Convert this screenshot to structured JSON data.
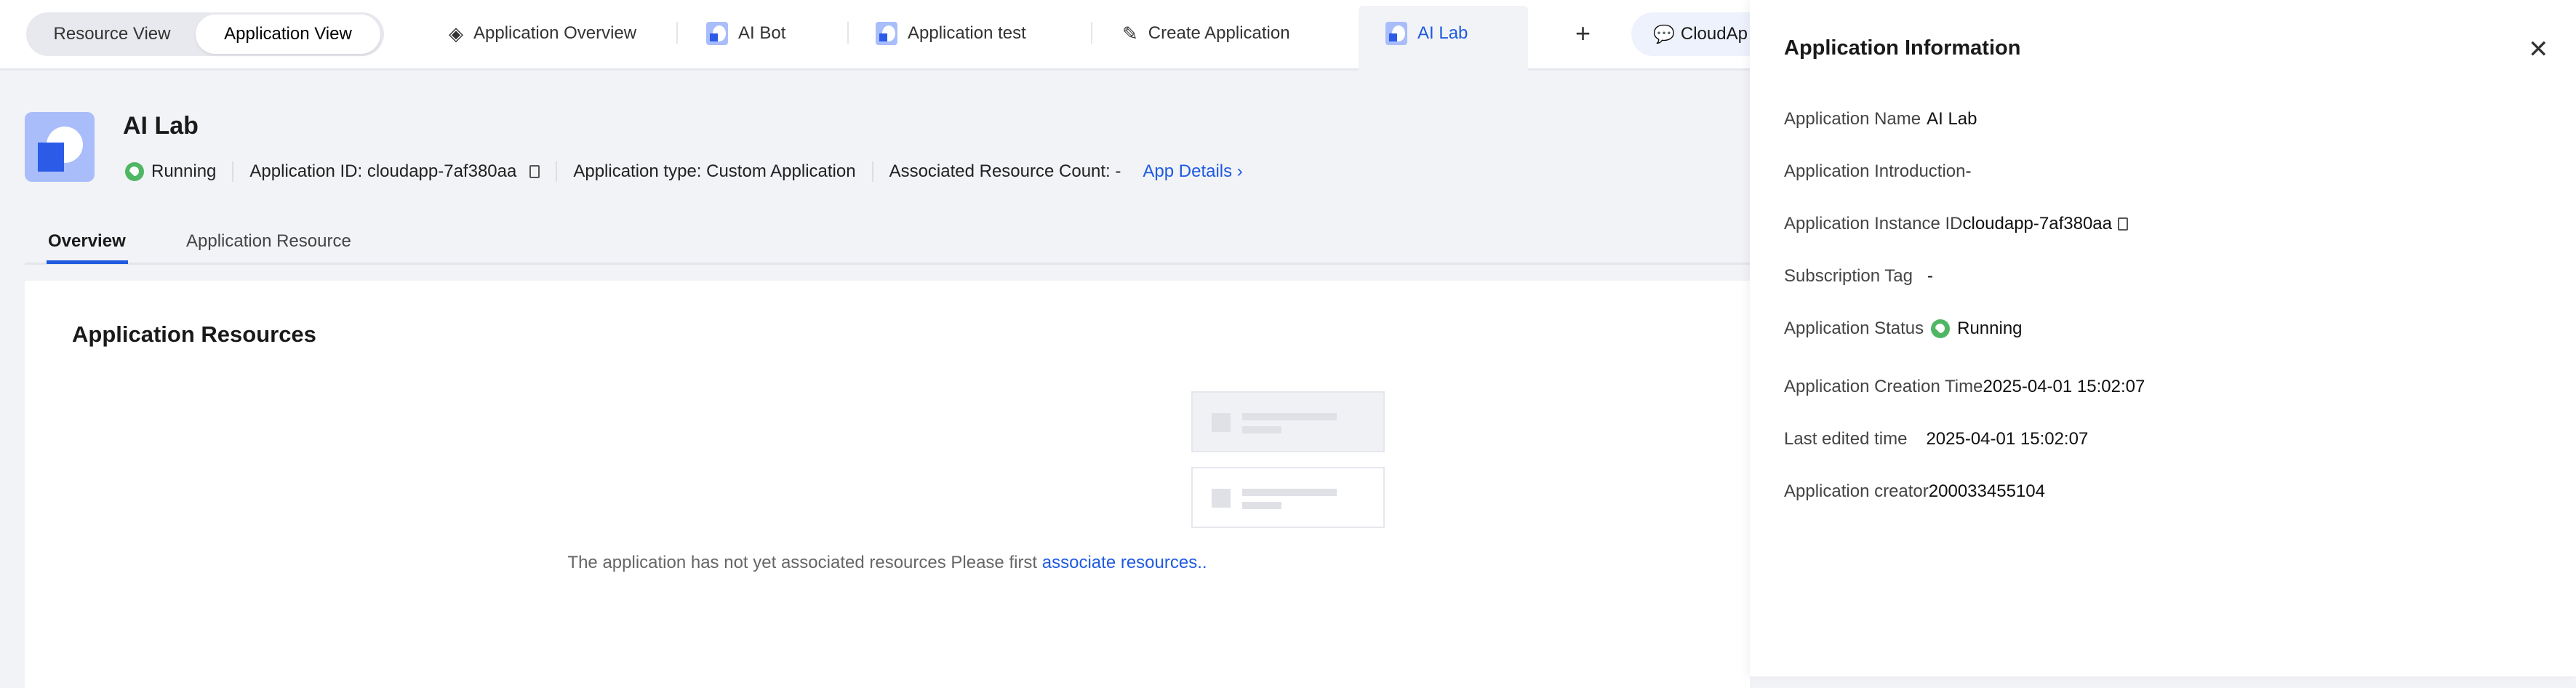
{
  "topbar": {
    "view_switch": {
      "resource": "Resource View",
      "application": "Application View"
    },
    "tabs": [
      {
        "label": "Application Overview",
        "icon": "layers-icon"
      },
      {
        "label": "AI Bot",
        "icon": "app-icon"
      },
      {
        "label": "Application test",
        "icon": "app-icon"
      },
      {
        "label": "Create Application",
        "icon": "pencil-icon"
      },
      {
        "label": "AI Lab",
        "icon": "app-icon",
        "active": true
      }
    ],
    "add": "+",
    "cloud": "CloudAp"
  },
  "app": {
    "name": "AI Lab",
    "status": "Running",
    "id_label": "Application ID: cloudapp-7af380aa",
    "type_label": "Application type: Custom Application",
    "resource_count": "Associated Resource Count: -",
    "details_link": "App Details"
  },
  "subtabs": [
    "Overview",
    "Application Resource"
  ],
  "resources": {
    "title": "Application Resources",
    "empty_text": "The application has not yet associated resources Please first ",
    "empty_link": "associate resources.."
  },
  "panel": {
    "title": "Application Information",
    "close": "✕",
    "rows": [
      {
        "label": "Application Name",
        "value": "AI Lab"
      },
      {
        "label": "Application Introduction",
        "value": "-"
      },
      {
        "label": "Application Instance ID",
        "value": "cloudapp-7af380aa"
      },
      {
        "label": "Subscription Tag",
        "value": "-"
      },
      {
        "label": "Application Status",
        "value": "Running"
      },
      {
        "label": "Application Creation Time",
        "value": "2025-04-01 15:02:07"
      },
      {
        "label": "Last edited time",
        "value": "2025-04-01 15:02:07"
      },
      {
        "label": "Application creator",
        "value": "200033455104"
      }
    ]
  },
  "colors": {
    "accent": "#1f5ae0",
    "running": "#4fb764"
  }
}
